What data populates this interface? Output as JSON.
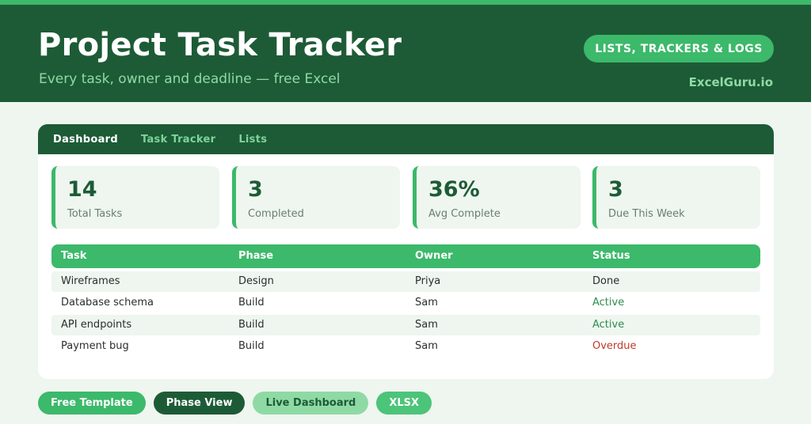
{
  "header": {
    "title": "Project Task Tracker",
    "subtitle": "Every task, owner and deadline — free Excel",
    "badge": "LISTS, TRACKERS & LOGS",
    "brand": "ExcelGuru.io"
  },
  "tabs": [
    {
      "label": "Dashboard",
      "active": true
    },
    {
      "label": "Task Tracker",
      "active": false
    },
    {
      "label": "Lists",
      "active": false
    }
  ],
  "kpis": [
    {
      "value": "14",
      "label": "Total Tasks"
    },
    {
      "value": "3",
      "label": "Completed"
    },
    {
      "value": "36%",
      "label": "Avg Complete"
    },
    {
      "value": "3",
      "label": "Due This Week"
    }
  ],
  "table": {
    "columns": [
      "Task",
      "Phase",
      "Owner",
      "Status"
    ],
    "rows": [
      {
        "task": "Wireframes",
        "phase": "Design",
        "owner": "Priya",
        "status": "Done"
      },
      {
        "task": "Database schema",
        "phase": "Build",
        "owner": "Sam",
        "status": "Active"
      },
      {
        "task": "API endpoints",
        "phase": "Build",
        "owner": "Sam",
        "status": "Active"
      },
      {
        "task": "Payment bug",
        "phase": "Build",
        "owner": "Sam",
        "status": "Overdue"
      }
    ]
  },
  "chips": [
    "Free Template",
    "Phase View",
    "Live Dashboard",
    "XLSX"
  ],
  "colors": {
    "dark_green": "#1d5b36",
    "accent_green": "#3cb96a",
    "light_green": "#8fdaa4",
    "status_active": "#2e8b4f",
    "status_overdue": "#c0392b"
  }
}
